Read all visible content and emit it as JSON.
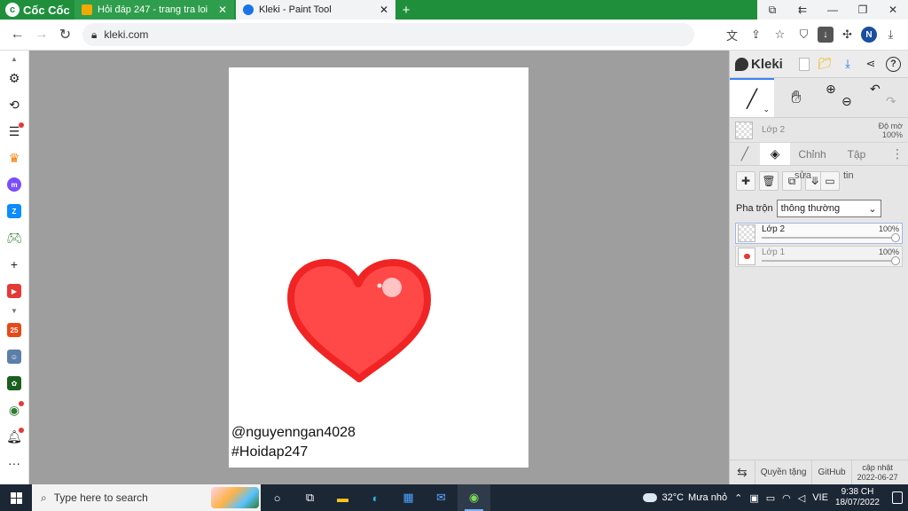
{
  "browser": {
    "brand": "Cốc Cốc",
    "tabs": [
      {
        "title": "Hỏi đáp 247 - trang tra loi",
        "active": false
      },
      {
        "title": "Kleki - Paint Tool",
        "active": true
      }
    ],
    "url": "kleki.com",
    "profile_initial": "N"
  },
  "canvas": {
    "watermark_line1": "@nguyenngan4028",
    "watermark_line2": "#Hoidap247",
    "heart_fill": "#ff4848",
    "heart_outline": "#f02424"
  },
  "kleki": {
    "logo_text": "Kleki",
    "mini_layer": {
      "name": "Lớp 2",
      "opacity_label": "Độ mờ",
      "opacity": "100%"
    },
    "subtabs": {
      "adjust": "Chỉnh",
      "file": "Tập"
    },
    "edit_label_1": "sửa",
    "edit_label_2": "tin",
    "blend_label": "Pha trộn",
    "blend_value": "thông thường",
    "layers": [
      {
        "name": "Lớp 2",
        "opacity": "100%",
        "selected": true
      },
      {
        "name": "Lớp 1",
        "opacity": "100%",
        "selected": false
      }
    ],
    "footer": {
      "license": "Quyền tặng",
      "github": "GitHub",
      "update_label": "cập nhật",
      "update_date": "2022-06-27"
    }
  },
  "taskbar": {
    "search_placeholder": "Type here to search",
    "temperature": "32°C",
    "weather": "Mưa nhỏ",
    "language": "VIE",
    "time": "9:38 CH",
    "date": "18/07/2022"
  },
  "colors": {
    "browser_green": "#1f8f3c",
    "workspace": "#9e9e9e",
    "taskbar": "#1c2735",
    "accent": "#3b82f6"
  }
}
